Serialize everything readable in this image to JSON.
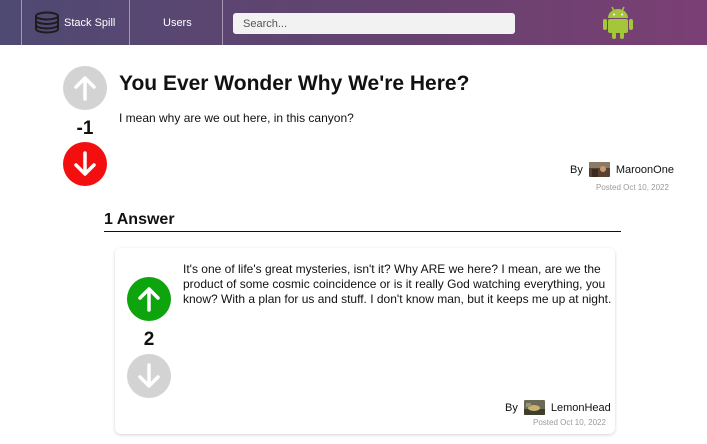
{
  "nav": {
    "brand": "Stack Spill",
    "users": "Users",
    "search_placeholder": "Search...",
    "search_value": ""
  },
  "question": {
    "title": "You Ever Wonder Why We're Here?",
    "body": "I mean why are we out here, in this canyon?",
    "score": "-1",
    "vote_state": "downvoted",
    "by_label": "By",
    "author": "MaroonOne",
    "posted": "Posted Oct 10, 2022"
  },
  "answers": {
    "heading": "1 Answer",
    "items": [
      {
        "body": "It's one of life's great mysteries, isn't it? Why ARE we here? I mean, are we the product of some cosmic coincidence or is it really God watching everything, you know? With a plan for us and stuff. I don't know man, but it keeps me up at night.",
        "score": "2",
        "vote_state": "upvoted",
        "by_label": "By",
        "author": "LemonHead",
        "posted": "Posted Oct 10, 2022"
      }
    ]
  },
  "colors": {
    "upvote_active": "#0da40d",
    "downvote_active": "#f30f0f",
    "vote_inactive": "#d3d3d3",
    "nav_gradient_start": "#4f4a73",
    "nav_gradient_end": "#7b3f74"
  },
  "icons": {
    "brand": "stack-logo-icon",
    "upvote": "arrow-up-icon",
    "downvote": "arrow-down-icon",
    "profile": "android-icon"
  }
}
